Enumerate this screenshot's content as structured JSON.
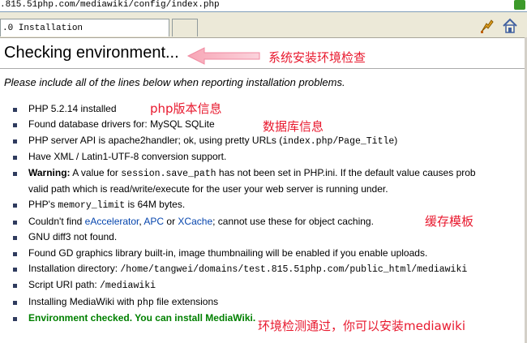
{
  "browser": {
    "address": ".815.51php.com/mediawiki/config/index.php",
    "tab_title": ".0 Installation"
  },
  "page": {
    "title": "Checking environment...",
    "hint": "Please include all of the lines below when reporting installation problems.",
    "checks": {
      "php_version": "PHP 5.2.14 installed",
      "db_drivers": "Found database drivers for: MySQL SQLite",
      "server_api_a": "PHP server API is apache2handler; ok, using pretty URLs (",
      "server_api_code": "index.php/Page_Title",
      "server_api_b": ")",
      "xml": "Have XML / Latin1-UTF-8 conversion support.",
      "warning_label": "Warning:",
      "warning_a": " A value for ",
      "warning_code": "session.save_path",
      "warning_b": " has not been set in PHP.ini. If the default value causes prob",
      "warning_c": "valid path which is read/write/execute for the user your web server is running under.",
      "memory_a": "PHP's ",
      "memory_code": "memory_limit",
      "memory_b": " is 64M bytes.",
      "cache_a": "Couldn't find ",
      "cache_link1": "eAccelerator",
      "cache_sep1": ", ",
      "cache_link2": "APC",
      "cache_sep2": " or ",
      "cache_link3": "XCache",
      "cache_b": "; cannot use these for object caching.",
      "diff3": "GNU diff3 not found.",
      "gd": "Found GD graphics library built-in, image thumbnailing will be enabled if you enable uploads.",
      "install_dir_a": "Installation directory: ",
      "install_dir_code": "/home/tangwei/domains/test.815.51php.com/public_html/mediawiki",
      "script_uri_a": "Script URI path: ",
      "script_uri_code": "/mediawiki",
      "ext_a": "Installing MediaWiki with ",
      "ext_code": "php",
      "ext_b": " file extensions",
      "result": "Environment checked. You can install MediaWiki."
    }
  },
  "annotations": {
    "check_env": "系统安装环境检查",
    "php_version": "php版本信息",
    "db_info": "数据库信息",
    "cache": "缓存模板",
    "passed": "环境检测通过，你可以安装mediawiki"
  },
  "colors": {
    "annotation": "#e8192e",
    "success": "#008000",
    "link": "#0645ad"
  }
}
